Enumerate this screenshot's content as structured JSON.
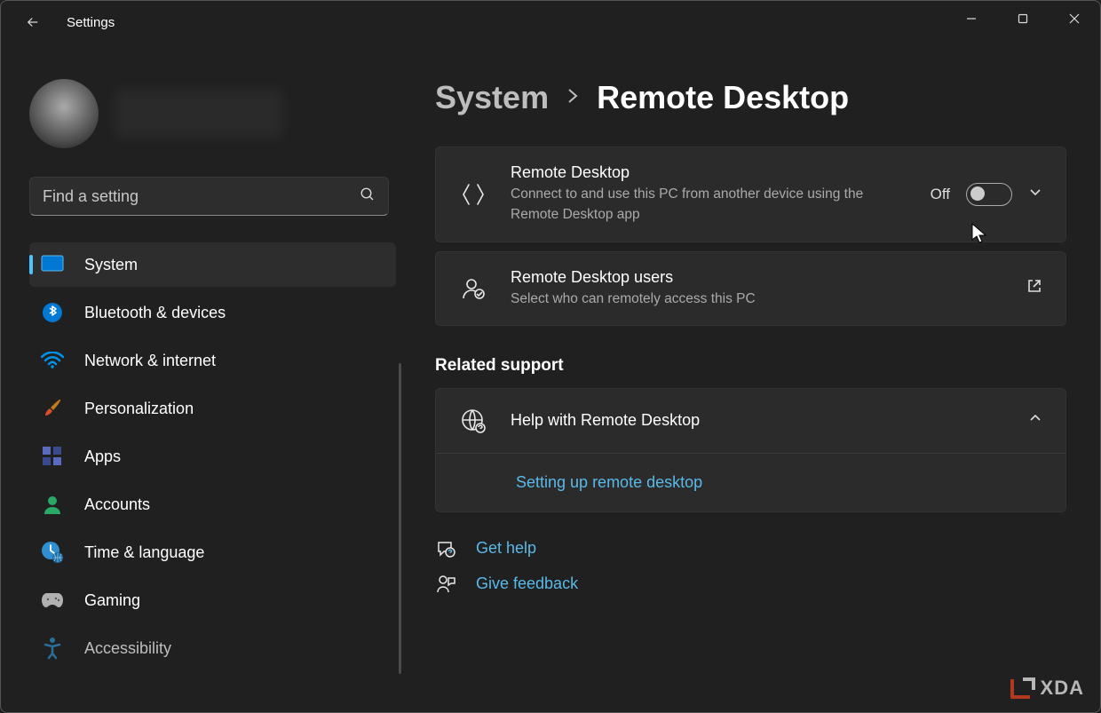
{
  "app": {
    "title": "Settings"
  },
  "search": {
    "placeholder": "Find a setting"
  },
  "sidebar": {
    "items": [
      {
        "label": "System",
        "icon": "system-icon",
        "color": "#0078d4",
        "active": true
      },
      {
        "label": "Bluetooth & devices",
        "icon": "bluetooth-icon",
        "color": "#0078d4"
      },
      {
        "label": "Network & internet",
        "icon": "wifi-icon",
        "color": "#0078d4"
      },
      {
        "label": "Personalization",
        "icon": "paintbrush-icon",
        "color": "#e8a33d"
      },
      {
        "label": "Apps",
        "icon": "apps-icon",
        "color": "#5a6bbf"
      },
      {
        "label": "Accounts",
        "icon": "person-icon",
        "color": "#2aa866"
      },
      {
        "label": "Time & language",
        "icon": "clock-globe-icon",
        "color": "#2f8fd0"
      },
      {
        "label": "Gaming",
        "icon": "gamepad-icon",
        "color": "#888"
      },
      {
        "label": "Accessibility",
        "icon": "accessibility-icon",
        "color": "#2f8fd0"
      }
    ]
  },
  "breadcrumb": {
    "parent": "System",
    "current": "Remote Desktop"
  },
  "cards": {
    "remote_desktop": {
      "title": "Remote Desktop",
      "desc": "Connect to and use this PC from another device using the Remote Desktop app",
      "toggle_state": "Off"
    },
    "users": {
      "title": "Remote Desktop users",
      "desc": "Select who can remotely access this PC"
    }
  },
  "related": {
    "heading": "Related support",
    "help": {
      "title": "Help with Remote Desktop",
      "link": "Setting up remote desktop"
    }
  },
  "footer": {
    "get_help": "Get help",
    "give_feedback": "Give feedback"
  },
  "watermark": "XDA"
}
